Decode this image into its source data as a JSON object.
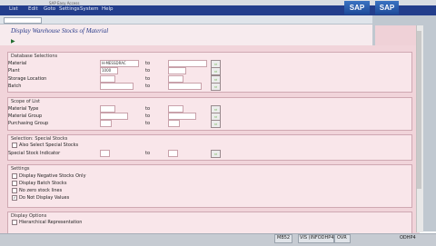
{
  "window": {
    "title": "SAP Easy Access"
  },
  "menu": [
    "List",
    "Edit",
    "Goto",
    "Settings",
    "System",
    "Help"
  ],
  "logo": "SAP",
  "title": "Display Warehouse Stocks of Material",
  "sections": {
    "database": {
      "title": "Database Selections",
      "rows": [
        {
          "label": "Material",
          "from": "H-MESSDRAC",
          "to": ""
        },
        {
          "label": "Plant",
          "from": "1000",
          "to": ""
        },
        {
          "label": "Storage Location",
          "from": "",
          "to": ""
        },
        {
          "label": "Batch",
          "from": "",
          "to": ""
        }
      ]
    },
    "scope": {
      "title": "Scope of List",
      "rows": [
        {
          "label": "Material Type",
          "from": "",
          "to": ""
        },
        {
          "label": "Material Group",
          "from": "",
          "to": ""
        },
        {
          "label": "Purchasing Group",
          "from": "",
          "to": ""
        }
      ]
    },
    "special": {
      "title": "Selection: Special Stocks",
      "checkbox": "Also Select Special Stocks",
      "row": {
        "label": "Special Stock Indicator",
        "from": "",
        "to": ""
      }
    },
    "settings": {
      "title": "Settings",
      "options": [
        {
          "label": "Display Negative Stocks Only",
          "checked": false
        },
        {
          "label": "Display Batch Stocks",
          "checked": false
        },
        {
          "label": "No zero stock lines",
          "checked": false
        },
        {
          "label": "Do Not Display Values",
          "checked": true
        }
      ]
    },
    "display": {
      "title": "Display Options",
      "options": [
        {
          "label": "Hierarchical Representation",
          "checked": false
        }
      ]
    }
  },
  "to_label": "to",
  "status": {
    "transaction": "MB52",
    "server": "VIS (INFODHP4)",
    "mode": "OVR",
    "right": "ODHP4"
  },
  "icons": {
    "multi_select": "multiple-selection-icon",
    "execute": "execute-icon"
  }
}
